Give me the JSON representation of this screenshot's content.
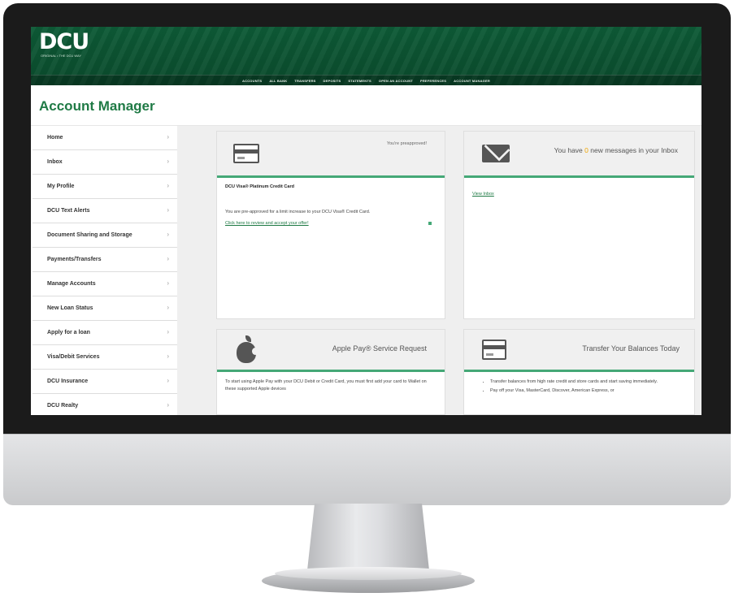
{
  "brand": {
    "logo_text": "DCU",
    "tagline": "ORIGINAL • THE DCU WAY",
    "accent_color": "#1f7a45",
    "banner_color": "#0d5a36"
  },
  "top_nav": [
    "ACCOUNTS",
    "ALL BANK",
    "TRANSFERS",
    "DEPOSITS",
    "STATEMENTS",
    "OPEN AN ACCOUNT",
    "PREFERENCES",
    "ACCOUNT MANAGER"
  ],
  "page_title": "Account Manager",
  "sidebar": {
    "items": [
      {
        "label": "Home",
        "icon": "chevron-right"
      },
      {
        "label": "Inbox",
        "icon": "chevron-right"
      },
      {
        "label": "My Profile",
        "icon": "chevron-right"
      },
      {
        "label": "DCU Text Alerts",
        "icon": "chevron-right"
      },
      {
        "label": "Document Sharing and Storage",
        "icon": "chevron-right"
      },
      {
        "label": "Payments/Transfers",
        "icon": "chevron-right"
      },
      {
        "label": "Manage Accounts",
        "icon": "chevron-right"
      },
      {
        "label": "New Loan Status",
        "icon": "chevron-right"
      },
      {
        "label": "Apply for a loan",
        "icon": "chevron-right"
      },
      {
        "label": "Visa/Debit Services",
        "icon": "chevron-right"
      },
      {
        "label": "DCU Insurance",
        "icon": "chevron-right"
      },
      {
        "label": "DCU Realty",
        "icon": "chevron-right"
      }
    ]
  },
  "cards": {
    "preapproved": {
      "icon": "credit-card-icon",
      "note": "You're preapproved!",
      "title": "DCU Visa® Platinum Credit Card",
      "body": "You are pre-approved for a limit increase to your DCU Visa® Credit Card.",
      "link": "Click here to review and accept your offer!"
    },
    "messages": {
      "icon": "envelope-icon",
      "text_before": "You have",
      "count": "0",
      "text_after": "new messages in your Inbox",
      "link": "View Inbox"
    },
    "apple_pay": {
      "icon": "apple-icon",
      "title": "Apple Pay® Service Request",
      "body": "To start using Apple Pay with your DCU Debit or Credit Card, you must first add your card to Wallet on these supported Apple devices"
    },
    "transfer": {
      "icon": "credit-card-icon",
      "title": "Transfer Your Balances Today",
      "bullets": [
        "Transfer balances from high rate credit and store cards and start saving immediately.",
        "Pay off your Visa, MasterCard, Discover, American Express, or"
      ]
    }
  }
}
